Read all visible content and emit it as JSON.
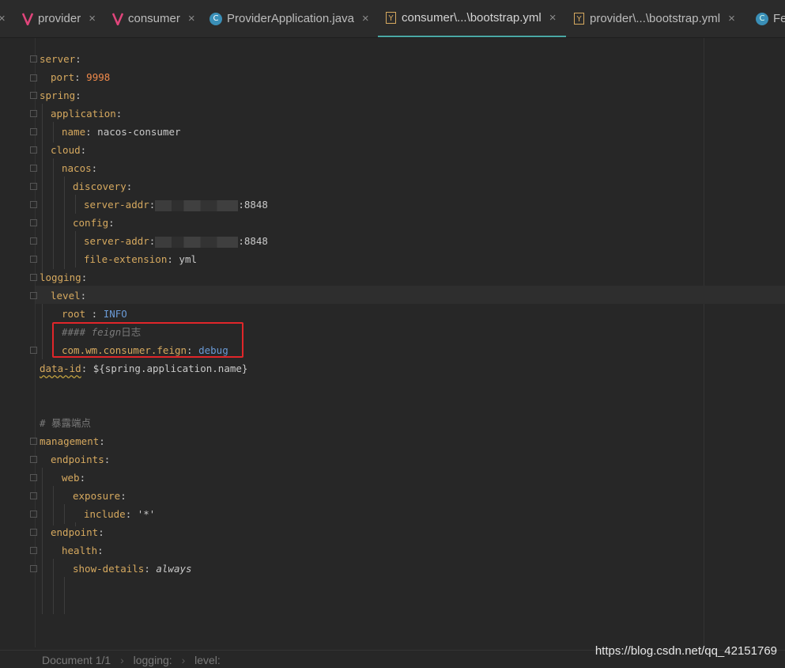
{
  "tabs": [
    {
      "label": "provider",
      "icon": "vue-icon"
    },
    {
      "label": "consumer",
      "icon": "vue-icon"
    },
    {
      "label": "ProviderApplication.java",
      "icon": "java-class-icon"
    },
    {
      "label": "consumer\\...\\bootstrap.yml",
      "icon": "yaml-icon",
      "active": true
    },
    {
      "label": "provider\\...\\bootstrap.yml",
      "icon": "yaml-icon"
    },
    {
      "label": "Fe",
      "icon": "class-icon"
    }
  ],
  "tab_close_glyph": "×",
  "code": {
    "server": "server",
    "port_key": "port",
    "port_val": "9998",
    "spring": "spring",
    "application": "application",
    "name_key": "name",
    "name_val": "nacos-consumer",
    "cloud": "cloud",
    "nacos": "nacos",
    "discovery": "discovery",
    "server_addr_key": "server-addr",
    "server_addr_port": ":8848",
    "config": "config",
    "file_ext_key": "file-extension",
    "file_ext_val": "yml",
    "logging": "logging",
    "level": "level",
    "root_key": "root ",
    "root_val": "INFO",
    "comment_hash": "#### ",
    "comment_feign": "feign",
    "comment_rest": "日志",
    "feign_key": "com.wm.consumer.feign",
    "feign_val": "debug",
    "data_id_key": "data-id",
    "data_id_val": "${spring.application.name}",
    "expose_comment": "# 暴露端点",
    "management": "management",
    "endpoints": "endpoints",
    "web": "web",
    "exposure": "exposure",
    "include_key": "include",
    "include_val": "'*'",
    "endpoint": "endpoint",
    "health": "health",
    "show_details_key": "show-details",
    "show_details_val": "always"
  },
  "status": {
    "document": "Document 1/1",
    "crumb1": "logging:",
    "crumb2": "level:"
  },
  "watermark": "https://blog.csdn.net/qq_42151769",
  "colors": {
    "accent": "#4aa8a4",
    "highlight": "#e0262a",
    "key": "#d6a95f",
    "number": "#f08a4b",
    "keyword": "#6a9ad6"
  }
}
